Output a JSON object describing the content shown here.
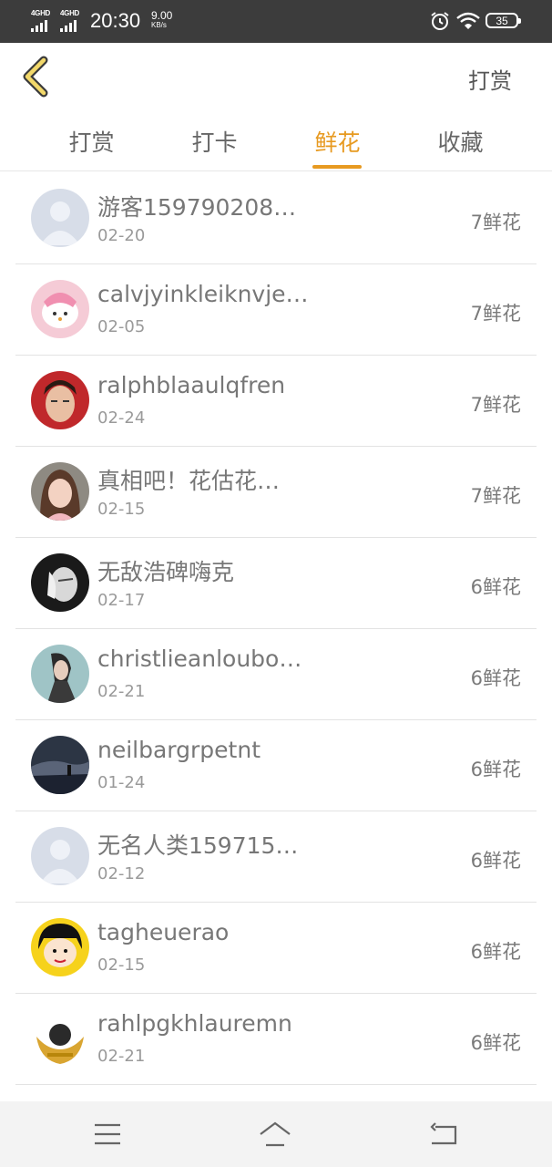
{
  "status_bar": {
    "sim1": "4GHD",
    "sim2": "4GHD",
    "time": "20:30",
    "speed": "9.00",
    "speed_unit": "KB/s",
    "battery": "35",
    "icons": [
      "signal-icon",
      "alarm-icon",
      "wifi-icon",
      "battery-icon"
    ]
  },
  "header": {
    "back_icon": "chevron-left-icon",
    "action_label": "打赏"
  },
  "tabs": [
    {
      "label": "打赏",
      "active": false
    },
    {
      "label": "打卡",
      "active": false
    },
    {
      "label": "鲜花",
      "active": true
    },
    {
      "label": "收藏",
      "active": false
    }
  ],
  "list": [
    {
      "name": "游客159790208…",
      "date": "02-20",
      "amount": "7鲜花",
      "avatar": "default-person"
    },
    {
      "name": "calvjyinkleiknvje…",
      "date": "02-05",
      "amount": "7鲜花",
      "avatar": "pink-cartoon"
    },
    {
      "name": "ralphblaaulqfren",
      "date": "02-24",
      "amount": "7鲜花",
      "avatar": "man-red-background"
    },
    {
      "name": "真相吧！花估花…",
      "date": "02-15",
      "amount": "7鲜花",
      "avatar": "girl-photo"
    },
    {
      "name": "无敌浩碑嗨克",
      "date": "02-17",
      "amount": "6鲜花",
      "avatar": "black-white-face"
    },
    {
      "name": "christlieanloubo…",
      "date": "02-21",
      "amount": "6鲜花",
      "avatar": "woman-teal"
    },
    {
      "name": "neilbargrpetnt",
      "date": "01-24",
      "amount": "6鲜花",
      "avatar": "dark-landscape"
    },
    {
      "name": "无名人类159715…",
      "date": "02-12",
      "amount": "6鲜花",
      "avatar": "default-person"
    },
    {
      "name": "tagheuerao",
      "date": "02-15",
      "amount": "6鲜花",
      "avatar": "yellow-cartoon"
    },
    {
      "name": "rahlpgkhlauremn",
      "date": "02-21",
      "amount": "6鲜花",
      "avatar": "gold-emblem"
    }
  ],
  "nav_bar": {
    "icons": [
      "menu-icon",
      "home-icon",
      "back-icon"
    ]
  },
  "colors": {
    "accent": "#e79a21",
    "status_bar_bg": "#3c3c3c",
    "divider": "#e3e3e3"
  }
}
